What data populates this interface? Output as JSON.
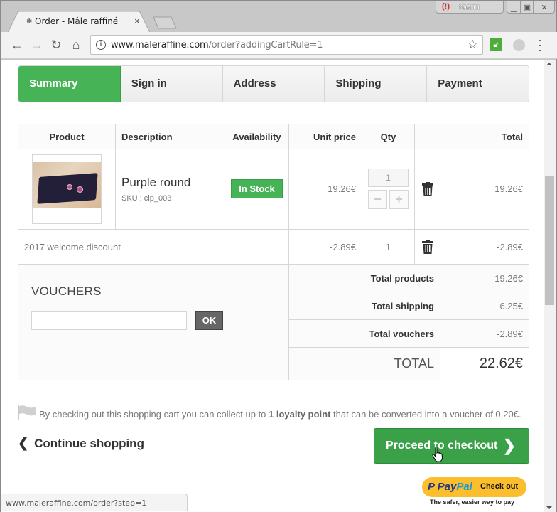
{
  "browser": {
    "tab_title": "Order - Mâle raffiné",
    "tab_close": "×",
    "profile_name": "Yoann",
    "url_host": "www.maleraffine.com",
    "url_path": "/order?addingCartRule=1",
    "status_url": "www.maleraffine.com/order?step=1"
  },
  "steps": [
    {
      "label": "Summary",
      "active": true
    },
    {
      "label": "Sign in",
      "active": false
    },
    {
      "label": "Address",
      "active": false
    },
    {
      "label": "Shipping",
      "active": false
    },
    {
      "label": "Payment",
      "active": false
    }
  ],
  "cart": {
    "headers": {
      "product": "Product",
      "description": "Description",
      "availability": "Availability",
      "unit_price": "Unit price",
      "qty": "Qty",
      "delete": "",
      "total": "Total"
    },
    "items": [
      {
        "name": "Purple round",
        "sku": "SKU : clp_003",
        "availability": "In Stock",
        "unit_price": "19.26€",
        "qty": "1",
        "total": "19.26€"
      }
    ],
    "discounts": [
      {
        "name": "2017 welcome discount",
        "unit_price": "-2.89€",
        "qty": "1",
        "total": "-2.89€"
      }
    ],
    "summary": {
      "total_products_label": "Total products",
      "total_products": "19.26€",
      "total_shipping_label": "Total shipping",
      "total_shipping": "6.25€",
      "total_vouchers_label": "Total vouchers",
      "total_vouchers": "-2.89€",
      "total_label": "TOTAL",
      "total": "22.62€"
    }
  },
  "vouchers": {
    "title": "VOUCHERS",
    "input_value": "",
    "ok_label": "OK"
  },
  "loyalty": {
    "prefix": "By checking out this shopping cart you can collect up to ",
    "points": "1 loyalty point",
    "suffix": " that can be converted into a voucher of 0.20€."
  },
  "actions": {
    "continue_label": "Continue shopping",
    "checkout_label": "Proceed to checkout",
    "paypal_pay": "Pay",
    "paypal_pal": "Pal",
    "paypal_checkout": "Check out",
    "paypal_tagline": "The safer, easier way to pay"
  },
  "colors": {
    "accent_green": "#46b356",
    "checkout_green": "#3ba148",
    "paypal_yellow": "#fcbe2d"
  }
}
